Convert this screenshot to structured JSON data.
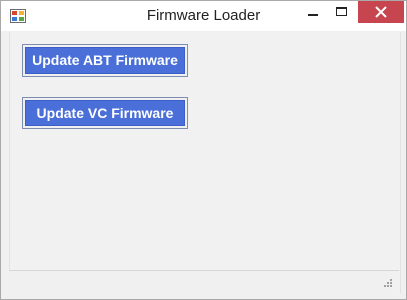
{
  "window": {
    "title": "Firmware Loader"
  },
  "title_controls": {
    "icons": [
      "app-icon",
      "minimize-icon",
      "maximize-icon",
      "close-icon"
    ]
  },
  "main": {
    "update_abt_label": "Update ABT Firmware",
    "update_vc_label": "Update VC Firmware"
  },
  "colors": {
    "button_fill": "#4a6fd8",
    "close_button": "#c7454e",
    "client_background": "#f2f1f1"
  }
}
